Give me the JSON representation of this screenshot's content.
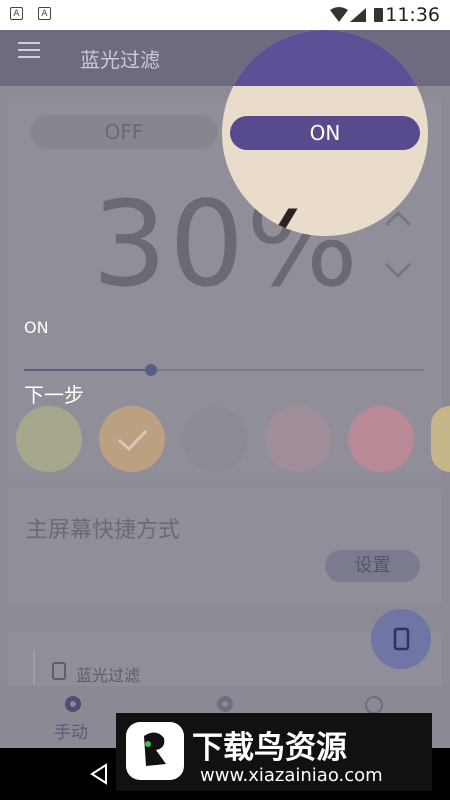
{
  "status_bar": {
    "time": "11:36",
    "notif_icons": [
      "notification-a-icon",
      "notification-a-icon"
    ]
  },
  "app_bar": {
    "title": "蓝光过滤",
    "menu_icon": "hamburger-menu-icon"
  },
  "filter_toggle": {
    "off_label": "OFF",
    "on_label": "ON",
    "selected": "ON"
  },
  "intensity": {
    "value_text": "30%",
    "value": 30
  },
  "tutorial": {
    "state_label": "ON",
    "next_label": "下一步"
  },
  "slider": {
    "value": 0.3
  },
  "color_swatches": [
    "#a7a88b",
    "#bca082",
    "#8c8a95",
    "#a08e98",
    "#b98a96",
    "#c6b78a"
  ],
  "selected_swatch_index": 1,
  "shortcut": {
    "title": "主屏幕快捷方式",
    "button_label": "设置"
  },
  "list": {
    "item_label": "蓝光过滤"
  },
  "bottom_nav": {
    "items": [
      {
        "label": "手动",
        "icon": "gear-icon"
      },
      {
        "label": "",
        "icon": "gear-icon"
      },
      {
        "label": "",
        "icon": "alarm-clock-icon"
      }
    ]
  },
  "watermark": {
    "title": "下载鸟资源",
    "url": "www.xiazainiao.com"
  },
  "colors": {
    "accent": "#574b8d",
    "highlight_bg": "#e9dccb",
    "appbar": "#6c6b80"
  }
}
